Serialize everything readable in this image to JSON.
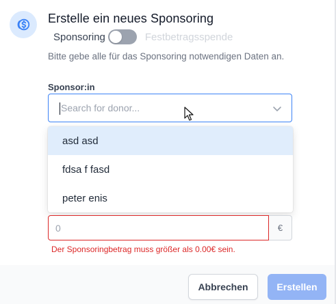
{
  "dialog": {
    "title": "Erstelle ein neues Sponsoring",
    "icon": "dollar-coin-icon",
    "accent_color": "#3b82f6",
    "toggle": {
      "left_label": "Sponsoring",
      "right_label": "Festbetragsspende",
      "state": "off"
    },
    "subtitle": "Bitte gebe alle für das Sponsoring notwendigen Daten an."
  },
  "sponsor": {
    "label": "Sponsor:in",
    "placeholder": "Search for donor...",
    "value": "",
    "options": [
      "asd asd",
      "fdsa f fasd",
      "peter enis"
    ],
    "highlighted_index": 0
  },
  "amount": {
    "value": "0",
    "currency": "€",
    "error": "Der Sponsoringbetrag muss größer als 0.00€ sein.",
    "error_color": "#dc2626"
  },
  "footer": {
    "cancel_label": "Abbrechen",
    "create_label": "Erstellen"
  }
}
